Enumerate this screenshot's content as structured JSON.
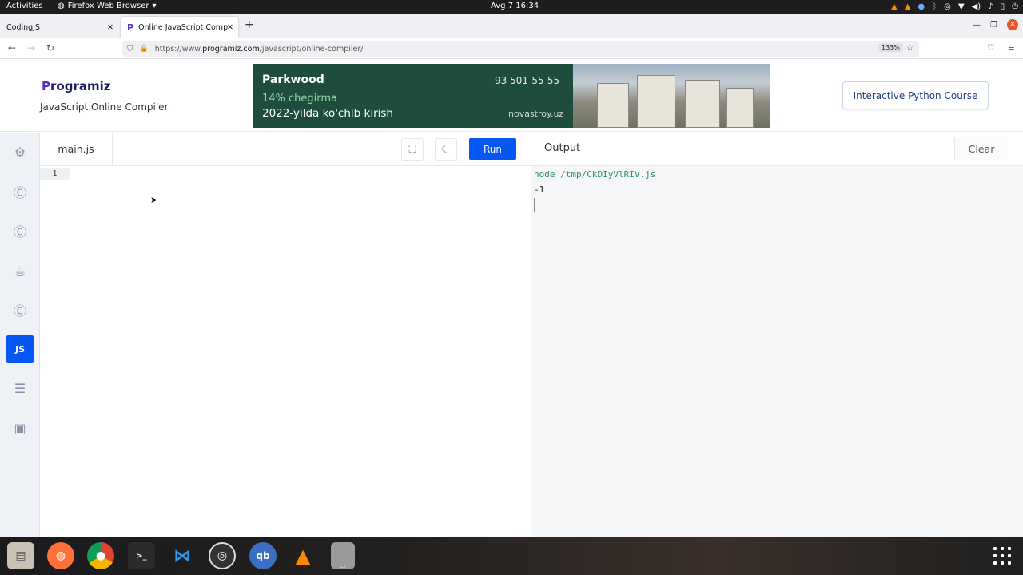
{
  "topbar": {
    "activities": "Activities",
    "app_menu": "Firefox Web Browser",
    "clock": "Avg 7  16:34"
  },
  "browser": {
    "tabs": [
      {
        "title": "CodingJS"
      },
      {
        "title": "Online JavaScript Compiler"
      }
    ],
    "url_prefix": "https://www.",
    "url_host": "programiz.com",
    "url_path": "/javascript/online-compiler/",
    "zoom": "133%"
  },
  "header": {
    "logo_p": "P",
    "logo_rest": "rogramiz",
    "subtitle": "JavaScript Online Compiler",
    "cta_label": "Interactive Python Course"
  },
  "ad": {
    "brand": "Parkwood",
    "phone": "93 501-55-55",
    "promo": "14% chegirma",
    "slogan": "2022-yilda ko'chib kirish",
    "site": "novastroy.uz"
  },
  "languages": [
    {
      "icon": "python-icon"
    },
    {
      "icon": "c-icon"
    },
    {
      "icon": "cpp-icon"
    },
    {
      "icon": "java-icon"
    },
    {
      "icon": "csharp-icon"
    },
    {
      "icon": "js-icon",
      "label": "JS",
      "active": true
    },
    {
      "icon": "sql-icon"
    },
    {
      "icon": "html5-icon"
    }
  ],
  "editor": {
    "filename": "main.js",
    "run_label": "Run",
    "line_number": "1"
  },
  "output": {
    "label": "Output",
    "clear_label": "Clear",
    "command": "node /tmp/CkDIyVlRIV.js",
    "result": "-1"
  },
  "colors": {
    "accent": "#0556f3",
    "brand_purple": "#5a2bc8",
    "command_green": "#2e8b73"
  }
}
